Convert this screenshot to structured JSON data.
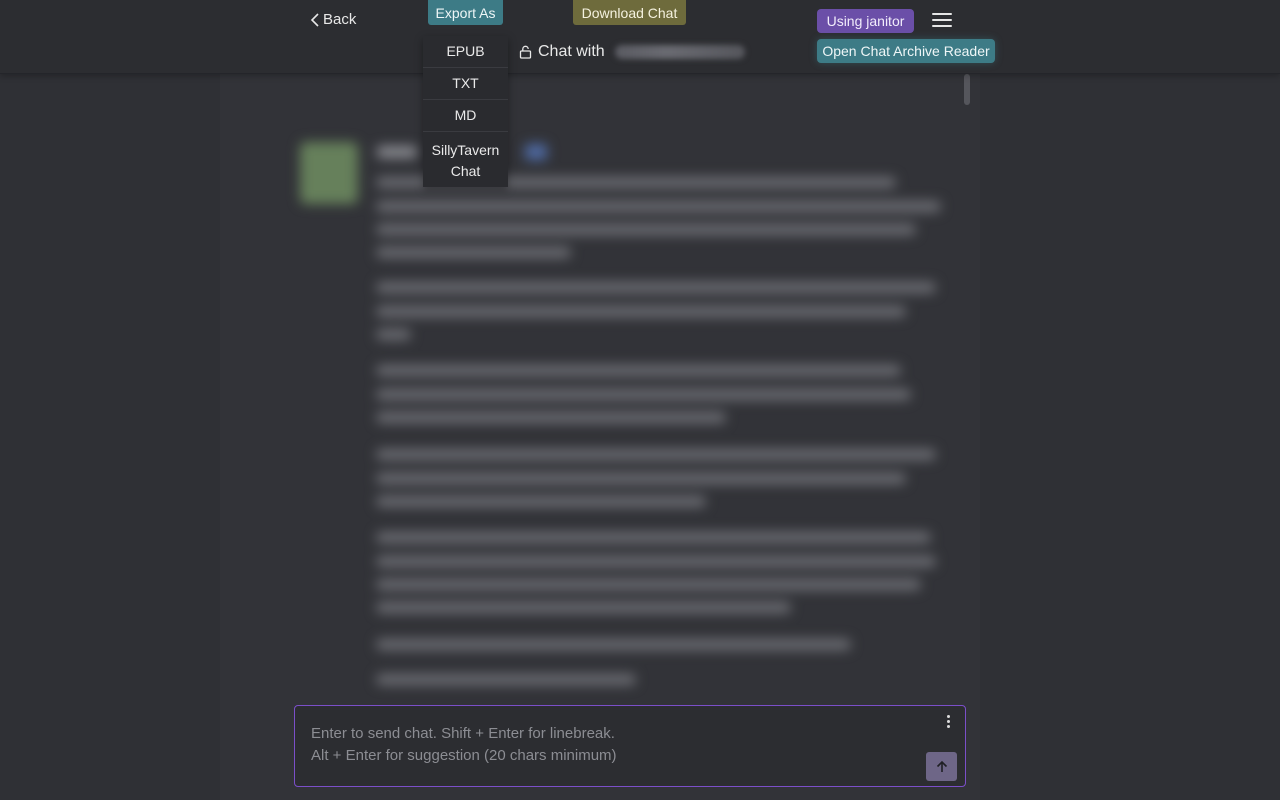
{
  "header": {
    "back_label": "Back",
    "export_label": "Export As",
    "download_label": "Download Chat",
    "chat_title_prefix": "Chat with",
    "using_label": "Using janitor",
    "archive_label": "Open Chat Archive Reader"
  },
  "export_menu": {
    "items": [
      "EPUB",
      "TXT",
      "MD",
      "SillyTavern Chat"
    ]
  },
  "composer": {
    "placeholder": "Enter to send chat. Shift + Enter for linebreak.\nAlt + Enter for suggestion (20 chars minimum)"
  },
  "icons": {
    "back": "chevron-left-icon",
    "lock": "lock-icon",
    "menu": "hamburger-menu-icon",
    "more": "kebab-menu-icon",
    "send": "arrow-up-icon"
  },
  "colors": {
    "background": "#2f3035",
    "export_button": "#3d7b86",
    "download_button": "#6e6b3c",
    "using_badge": "#6b4fa8",
    "composer_border": "#7b4fc9"
  }
}
